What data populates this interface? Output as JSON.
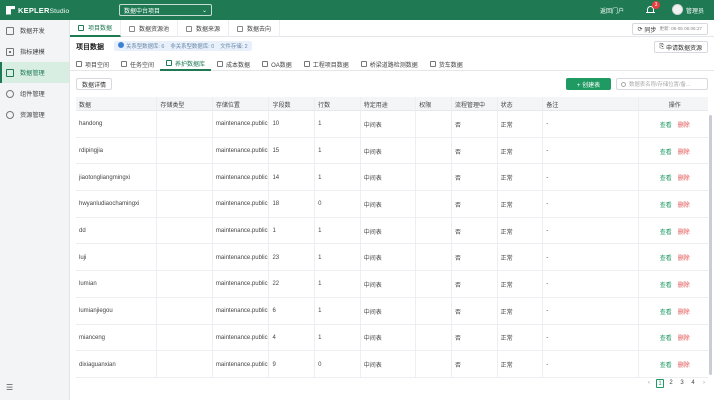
{
  "header": {
    "brand": "KEPLER",
    "brand_suffix": "Studio",
    "project_select": "数据中台项目",
    "back_portal": "返回门户",
    "notification_count": "3",
    "username": "管理员"
  },
  "sidebar": {
    "items": [
      {
        "label": "数据开发",
        "icon": "code-icon"
      },
      {
        "label": "指标建模",
        "icon": "metric-icon"
      },
      {
        "label": "数据管理",
        "icon": "database-icon"
      },
      {
        "label": "组件管理",
        "icon": "component-icon"
      },
      {
        "label": "资源管理",
        "icon": "resource-icon"
      }
    ],
    "active_index": 2,
    "collapse_glyph": "☰"
  },
  "page_tabs": [
    "项目数据",
    "数据资源池",
    "数据来源",
    "数据去向"
  ],
  "main": {
    "title": "项目数据",
    "stats": {
      "relational": "关系型数据库: 6",
      "non_relational": "非关系型数据库: 0",
      "file_storage": "文件存储: 2"
    },
    "sync_label": "同步",
    "sync_time": "更新: 06-05 06:06:27",
    "apply_label": "申请数据资源",
    "sub_tabs": [
      "项目空间",
      "任务空间",
      "养护数据库",
      "成本数据",
      "OA数据",
      "工程项目数据",
      "桥梁道路检测数据",
      "货车数据"
    ],
    "active_sub_tab": 2,
    "toolbar_btn": "数据详情",
    "create_label": "+ 创建表",
    "search_placeholder": "数据表名称/存储位置/备..."
  },
  "table": {
    "headers": [
      "数据",
      "存储类型",
      "存储位置",
      "字段数",
      "行数",
      "特定用途",
      "权限",
      "流程管理中",
      "状态",
      "备注",
      "操作"
    ],
    "rows": [
      {
        "name": "handong",
        "type": "",
        "location": "maintenance.public",
        "fields": "10",
        "rows": "1",
        "purpose": "中间表",
        "perm": "",
        "flow": "否",
        "status": "正常",
        "note": "-"
      },
      {
        "name": "rdipingjia",
        "type": "",
        "location": "maintenance.public",
        "fields": "15",
        "rows": "1",
        "purpose": "中间表",
        "perm": "",
        "flow": "否",
        "status": "正常",
        "note": "-"
      },
      {
        "name": "jiaotongliangmingxi",
        "type": "",
        "location": "maintenance.public",
        "fields": "14",
        "rows": "1",
        "purpose": "中间表",
        "perm": "",
        "flow": "否",
        "status": "正常",
        "note": "-"
      },
      {
        "name": "hwyanludiaochamingxi",
        "type": "",
        "location": "maintenance.public",
        "fields": "18",
        "rows": "0",
        "purpose": "中间表",
        "perm": "",
        "flow": "否",
        "status": "正常",
        "note": "-"
      },
      {
        "name": "dd",
        "type": "",
        "location": "maintenance.public",
        "fields": "1",
        "rows": "1",
        "purpose": "中间表",
        "perm": "",
        "flow": "否",
        "status": "正常",
        "note": "-"
      },
      {
        "name": "luji",
        "type": "",
        "location": "maintenance.public",
        "fields": "23",
        "rows": "1",
        "purpose": "中间表",
        "perm": "",
        "flow": "否",
        "status": "正常",
        "note": "-"
      },
      {
        "name": "lumian",
        "type": "",
        "location": "maintenance.public",
        "fields": "22",
        "rows": "1",
        "purpose": "中间表",
        "perm": "",
        "flow": "否",
        "status": "正常",
        "note": "-"
      },
      {
        "name": "lumianjiegou",
        "type": "",
        "location": "maintenance.public",
        "fields": "6",
        "rows": "1",
        "purpose": "中间表",
        "perm": "",
        "flow": "否",
        "status": "正常",
        "note": "-"
      },
      {
        "name": "mianceng",
        "type": "",
        "location": "maintenance.public",
        "fields": "4",
        "rows": "1",
        "purpose": "中间表",
        "perm": "",
        "flow": "否",
        "status": "正常",
        "note": "-"
      },
      {
        "name": "dixiaguanxian",
        "type": "",
        "location": "maintenance.public",
        "fields": "9",
        "rows": "0",
        "purpose": "中间表",
        "perm": "",
        "flow": "否",
        "status": "正常",
        "note": "-"
      }
    ],
    "view_label": "查看",
    "delete_label": "删除"
  },
  "pager": {
    "prev": "‹",
    "pages": [
      "1",
      "2",
      "3",
      "4"
    ],
    "next": "›",
    "active": "1"
  },
  "colors": {
    "brand": "#1f7a53",
    "primary": "#1f9a62",
    "danger": "#e05050"
  }
}
